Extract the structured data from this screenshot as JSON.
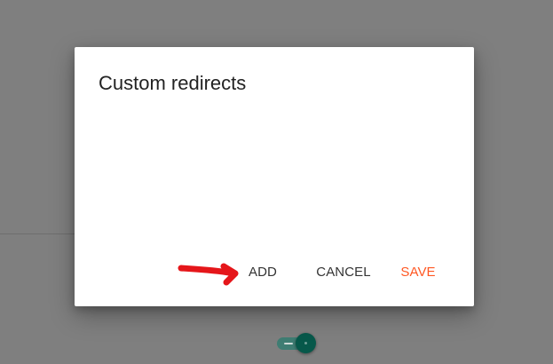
{
  "dialog": {
    "title": "Custom redirects",
    "actions": {
      "add_label": "ADD",
      "cancel_label": "CANCEL",
      "save_label": "SAVE"
    }
  },
  "background": {
    "toggle": {
      "state": "on"
    }
  },
  "annotation": {
    "icon": "arrow-right-icon"
  },
  "colors": {
    "overlay": "#7f7f7f",
    "dialog_background": "#ffffff",
    "title_text": "#222222",
    "secondary_action": "#333333",
    "primary_action": "#ff5722",
    "toggle_track": "#3f7d73",
    "toggle_knob": "#07584a",
    "annotation_arrow": "#e5161a"
  }
}
